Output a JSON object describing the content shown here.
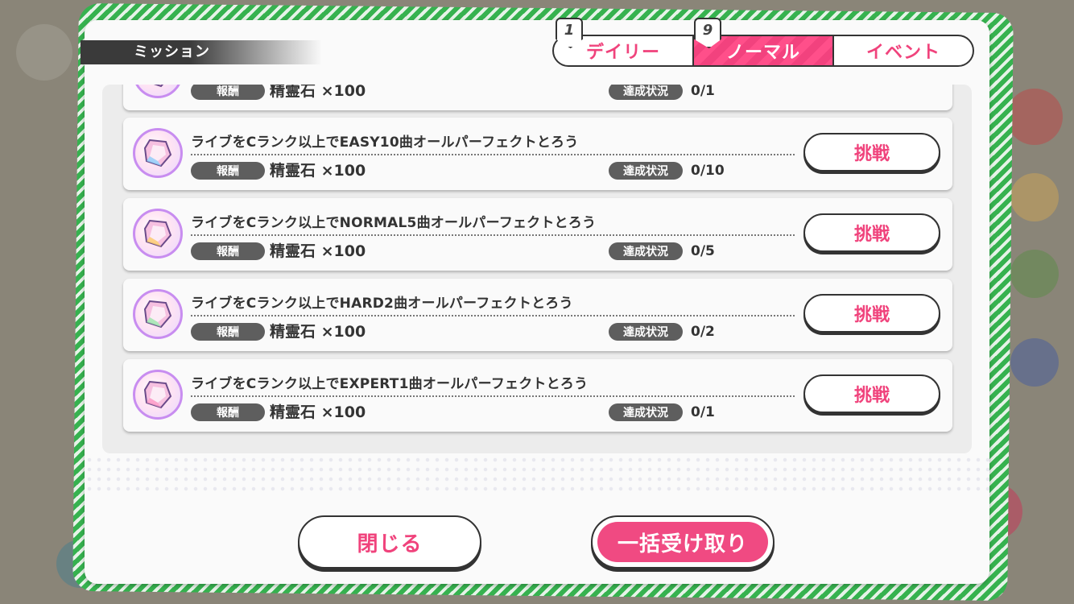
{
  "header": {
    "title": "ミッション"
  },
  "tabs": [
    {
      "label": "デイリー",
      "badge": "1",
      "active": false
    },
    {
      "label": "ノーマル",
      "badge": "9",
      "active": true
    },
    {
      "label": "イベント",
      "badge": "",
      "active": false
    }
  ],
  "missions": [
    {
      "title": "",
      "reward_label": "報酬",
      "reward": "精霊石 ×100",
      "status_label": "達成状況",
      "progress": "0/1",
      "button": ""
    },
    {
      "title": "ライブをCランク以上でEASY10曲オールパーフェクトとろう",
      "reward_label": "報酬",
      "reward": "精霊石 ×100",
      "status_label": "達成状況",
      "progress": "0/10",
      "button": "挑戦"
    },
    {
      "title": "ライブをCランク以上でNORMAL5曲オールパーフェクトとろう",
      "reward_label": "報酬",
      "reward": "精霊石 ×100",
      "status_label": "達成状況",
      "progress": "0/5",
      "button": "挑戦"
    },
    {
      "title": "ライブをCランク以上でHARD2曲オールパーフェクトとろう",
      "reward_label": "報酬",
      "reward": "精霊石 ×100",
      "status_label": "達成状況",
      "progress": "0/2",
      "button": "挑戦"
    },
    {
      "title": "ライブをCランク以上でEXPERT1曲オールパーフェクトとろう",
      "reward_label": "報酬",
      "reward": "精霊石 ×100",
      "status_label": "達成状況",
      "progress": "0/1",
      "button": "挑戦"
    }
  ],
  "footer": {
    "close_label": "閉じる",
    "collect_all_label": "一括受け取り"
  },
  "colors": {
    "accent": "#f0437c",
    "frame": "#36b24f",
    "dark": "#333333"
  }
}
